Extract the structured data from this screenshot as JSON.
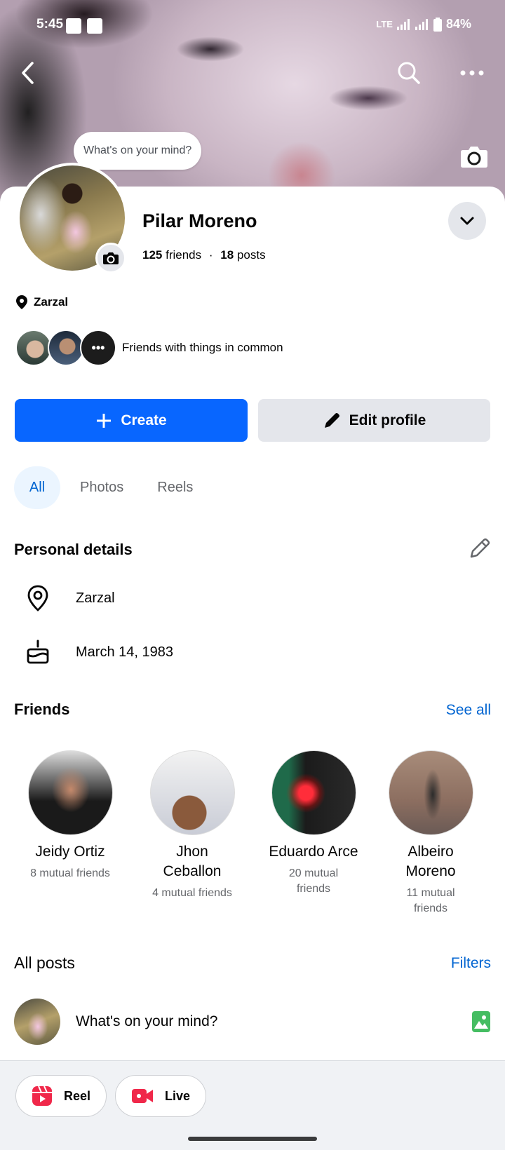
{
  "status_bar": {
    "time": "5:45",
    "network": "LTE",
    "battery": "84%"
  },
  "cover": {
    "bubble_text": "What's on your mind?"
  },
  "profile": {
    "name": "Pilar Moreno",
    "friends_count": "125",
    "friends_label": "friends",
    "separator": "·",
    "posts_count": "18",
    "posts_label": "posts",
    "location": "Zarzal",
    "mutual_text": "Friends with things in common"
  },
  "actions": {
    "create_label": "Create",
    "edit_label": "Edit profile"
  },
  "tabs": [
    {
      "label": "All",
      "active": true
    },
    {
      "label": "Photos",
      "active": false
    },
    {
      "label": "Reels",
      "active": false
    }
  ],
  "personal_details": {
    "title": "Personal details",
    "items": [
      {
        "icon": "location-pin-icon",
        "text": "Zarzal"
      },
      {
        "icon": "birthday-cake-icon",
        "text": "March 14, 1983"
      }
    ]
  },
  "friends": {
    "title": "Friends",
    "see_all": "See all",
    "items": [
      {
        "name": "Jeidy Ortiz",
        "mutual": "8 mutual friends"
      },
      {
        "name": "Jhon Ceballon",
        "mutual": "4 mutual friends"
      },
      {
        "name": "Eduardo Arce",
        "mutual": "20 mutual friends"
      },
      {
        "name": "Albeiro Moreno",
        "mutual": "11 mutual friends"
      }
    ]
  },
  "posts": {
    "title": "All posts",
    "filters": "Filters",
    "composer_placeholder": "What's on your mind?"
  },
  "bottom_actions": {
    "reel_label": "Reel",
    "live_label": "Live"
  },
  "colors": {
    "accent": "#0866ff",
    "link": "#0064d1",
    "reel": "#f0284a",
    "photo": "#45bd62"
  }
}
